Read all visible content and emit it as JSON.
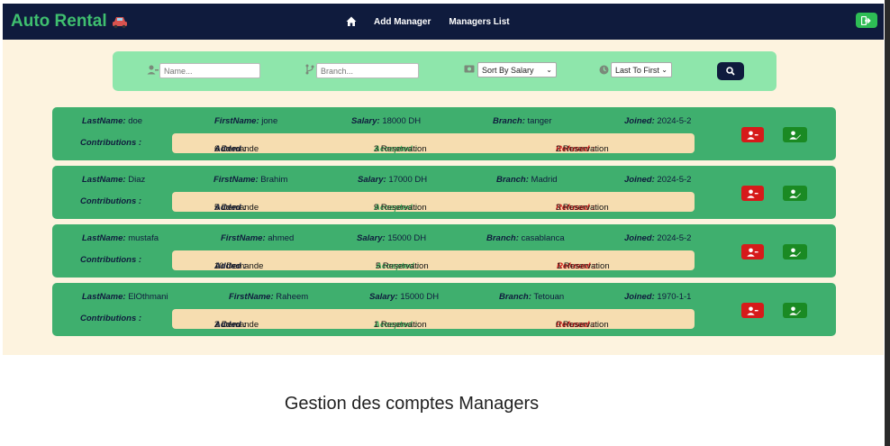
{
  "navbar": {
    "brand": "Auto Rental",
    "links": [
      "Add Manager",
      "Managers List"
    ],
    "brand_color": "#3fbf6f",
    "bg_color": "#0f1b3d"
  },
  "filter": {
    "name_placeholder": "Name...",
    "branch_placeholder": "Branch...",
    "sort_selected": "Sort By Salary",
    "order_selected": "Last To First"
  },
  "managers": [
    {
      "lastname_label": "LastName:",
      "lastname": "doe",
      "firstname_label": "FirstName:",
      "firstname": "jone",
      "salary_label": "Salary:",
      "salary": "18000 DH",
      "branch_label": "Branch:",
      "branch": "tanger",
      "joined_label": "Joined:",
      "joined": "2024-5-2",
      "contrib_label": "Contributions :",
      "added_label": "Added :",
      "added": "6 Demande",
      "accepted_label": "Accepted :",
      "accepted": "3 Reservation",
      "refused_label": "Refused :",
      "refused": "2 Reservation"
    },
    {
      "lastname_label": "LastName:",
      "lastname": "Diaz",
      "firstname_label": "FirstName:",
      "firstname": "Brahim",
      "salary_label": "Salary:",
      "salary": "17000 DH",
      "branch_label": "Branch:",
      "branch": "Madrid",
      "joined_label": "Joined:",
      "joined": "2024-5-2",
      "contrib_label": "Contributions :",
      "added_label": "Added :",
      "added": "5 Demande",
      "accepted_label": "Accepted :",
      "accepted": "9 Reservation",
      "refused_label": "Refused :",
      "refused": "3 Reservation"
    },
    {
      "lastname_label": "LastName:",
      "lastname": "mustafa",
      "firstname_label": "FirstName:",
      "firstname": "ahmed",
      "salary_label": "Salary:",
      "salary": "15000 DH",
      "branch_label": "Branch:",
      "branch": "casablanca",
      "joined_label": "Joined:",
      "joined": "2024-5-2",
      "contrib_label": "Contributions :",
      "added_label": "Added :",
      "added": "10 Demande",
      "accepted_label": "Accepted :",
      "accepted": "5 Reservation",
      "refused_label": "Refused :",
      "refused": "1 Reservation"
    },
    {
      "lastname_label": "LastName:",
      "lastname": "ElOthmani",
      "firstname_label": "FirstName:",
      "firstname": "Raheem",
      "salary_label": "Salary:",
      "salary": "15000 DH",
      "branch_label": "Branch:",
      "branch": "Tetouan",
      "joined_label": "Joined:",
      "joined": "1970-1-1",
      "contrib_label": "Contributions :",
      "added_label": "Added :",
      "added": "2 Demande",
      "accepted_label": "Accepted :",
      "accepted": "1 Reservation",
      "refused_label": "Refused :",
      "refused": "0 Reservation"
    }
  ],
  "caption": "Gestion des comptes Managers",
  "colors": {
    "content_bg": "#fdf3df",
    "filter_bg": "#8ee6ab",
    "card_bg": "#3faf6e",
    "contrib_bg": "#f6ddb0",
    "delete_red": "#d61a1a",
    "edit_green": "#1a8a23",
    "accepted_green": "#3fae5c",
    "refused_red": "#d01717"
  }
}
